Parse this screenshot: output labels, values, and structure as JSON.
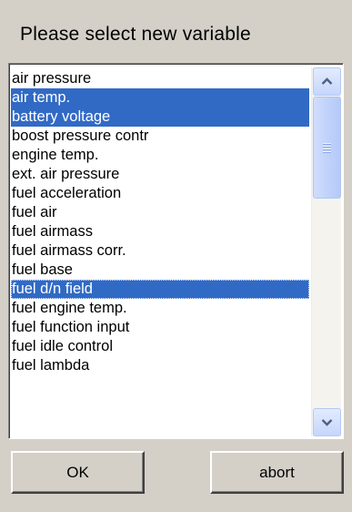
{
  "dialog": {
    "prompt": "Please select new variable"
  },
  "variable_list": {
    "items": [
      {
        "label": "air pressure",
        "selected": false
      },
      {
        "label": "air temp.",
        "selected": true
      },
      {
        "label": "battery voltage",
        "selected": true
      },
      {
        "label": "boost pressure contr",
        "selected": false
      },
      {
        "label": "engine temp.",
        "selected": false
      },
      {
        "label": "ext. air pressure",
        "selected": false
      },
      {
        "label": "fuel acceleration",
        "selected": false
      },
      {
        "label": "fuel air",
        "selected": false
      },
      {
        "label": "fuel airmass",
        "selected": false
      },
      {
        "label": "fuel airmass corr.",
        "selected": false
      },
      {
        "label": "fuel base",
        "selected": false
      },
      {
        "label": "fuel d/n field",
        "selected": true,
        "focused": true
      },
      {
        "label": "fuel engine temp.",
        "selected": false
      },
      {
        "label": "fuel function input",
        "selected": false
      },
      {
        "label": "fuel idle control",
        "selected": false
      },
      {
        "label": "fuel lambda",
        "selected": false
      }
    ],
    "selection_color": "#316ac5"
  },
  "scrollbar": {
    "up_icon": "chevron-up-icon",
    "down_icon": "chevron-down-icon",
    "thumb_icon": "grip-icon"
  },
  "buttons": {
    "ok_label": "OK",
    "abort_label": "abort"
  }
}
